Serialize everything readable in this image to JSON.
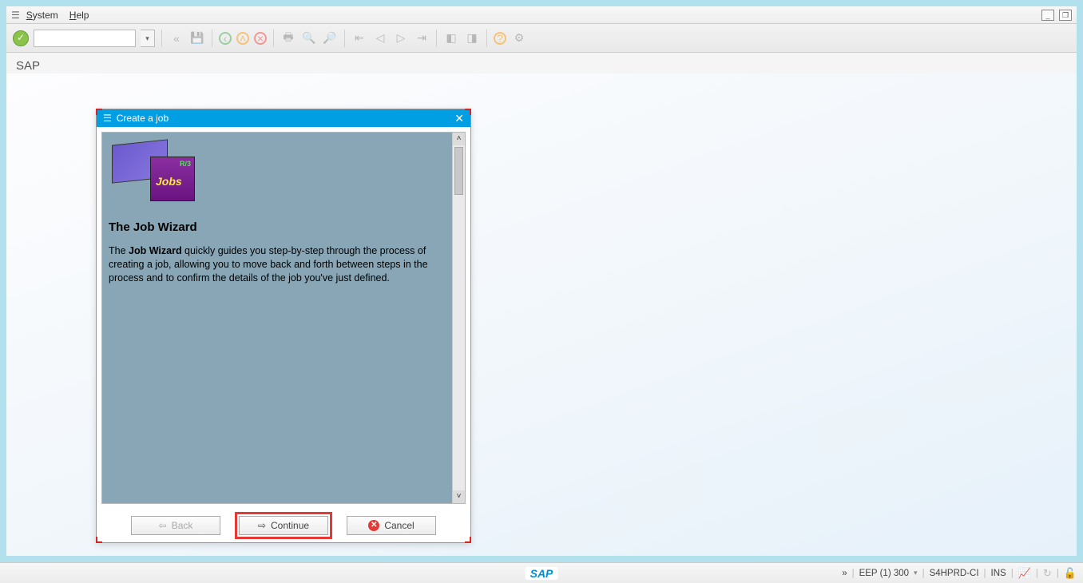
{
  "menubar": {
    "system": "System",
    "help": "Help"
  },
  "app_title": "SAP",
  "dialog": {
    "title": "Create a job",
    "wizard_img": {
      "r3": "R/3",
      "jobs": "Jobs"
    },
    "heading": "The Job Wizard",
    "body_prefix": "The ",
    "body_bold": "Job Wizard",
    "body_rest": " quickly guides you step-by-step through the process of creating a job, allowing you to move back and forth between steps in the process and to confirm the details of the job you've just defined.",
    "buttons": {
      "back": "Back",
      "continue": "Continue",
      "cancel": "Cancel"
    }
  },
  "status": {
    "expand": "»",
    "system": "EEP (1) 300",
    "server": "S4HPRD-CI",
    "mode": "INS"
  }
}
